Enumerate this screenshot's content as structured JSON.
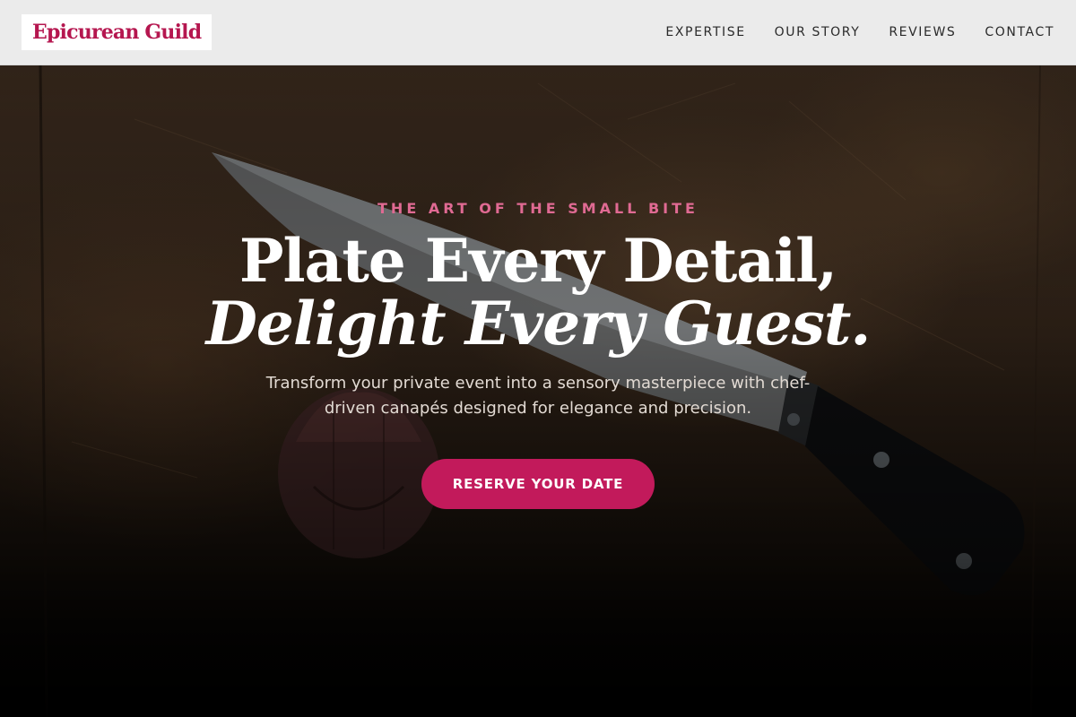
{
  "header": {
    "logo_text": "Epicurean Guild",
    "nav": [
      {
        "label": "EXPERTISE"
      },
      {
        "label": "OUR STORY"
      },
      {
        "label": "REVIEWS"
      },
      {
        "label": "CONTACT"
      }
    ]
  },
  "hero": {
    "eyebrow": "THE ART OF THE SMALL BITE",
    "headline_line1": "Plate Every Detail,",
    "headline_line2": "Delight Every Guest.",
    "subtext": "Transform your private event into a sensory masterpiece with chef-driven canapés designed for elegance and precision.",
    "cta_label": "RESERVE YOUR DATE",
    "background_image": "chef-knife-on-cutting-board-with-garlic"
  },
  "colors": {
    "accent": "#c21a5b",
    "logo": "#b5164f",
    "eyebrow": "#e06a93",
    "header_bg": "#ebebeb"
  }
}
